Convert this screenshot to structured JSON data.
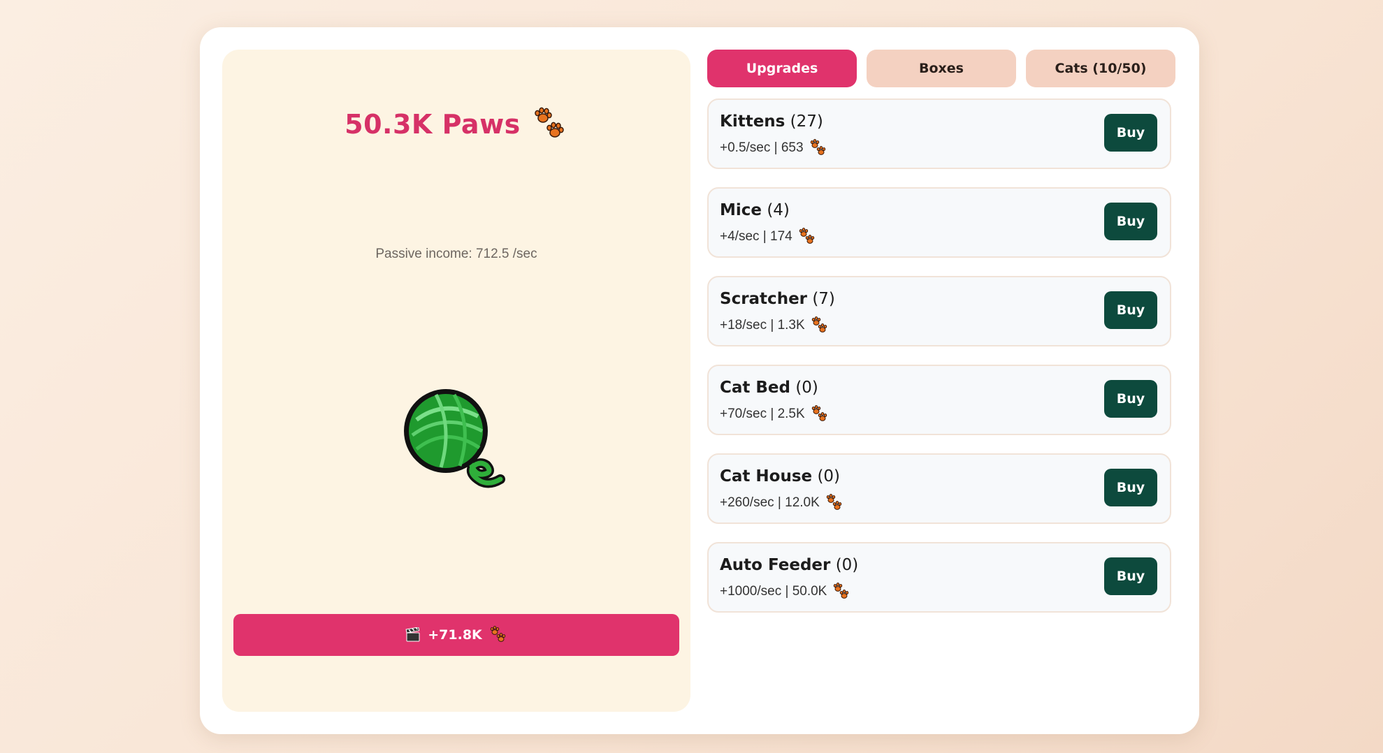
{
  "game": {
    "paws_count": "50.3K Paws",
    "passive_income": "Passive income: 712.5 /sec",
    "yarn_icon": "yarn-ball-icon",
    "paw_icon": "paw-prints-icon"
  },
  "ad_button": {
    "icon": "clapperboard-icon",
    "label": "+71.8K"
  },
  "tabs": [
    {
      "label": "Upgrades",
      "active": true
    },
    {
      "label": "Boxes",
      "active": false
    },
    {
      "label": "Cats (10/50)",
      "active": false
    }
  ],
  "upgrades": [
    {
      "name": "Kittens",
      "count": "(27)",
      "detail": "+0.5/sec | 653",
      "buy_label": "Buy"
    },
    {
      "name": "Mice",
      "count": "(4)",
      "detail": "+4/sec | 174",
      "buy_label": "Buy"
    },
    {
      "name": "Scratcher",
      "count": "(7)",
      "detail": "+18/sec | 1.3K",
      "buy_label": "Buy"
    },
    {
      "name": "Cat Bed",
      "count": "(0)",
      "detail": "+70/sec | 2.5K",
      "buy_label": "Buy"
    },
    {
      "name": "Cat House",
      "count": "(0)",
      "detail": "+260/sec | 12.0K",
      "buy_label": "Buy"
    },
    {
      "name": "Auto Feeder",
      "count": "(0)",
      "detail": "+1000/sec | 50.0K",
      "buy_label": "Buy"
    }
  ],
  "colors": {
    "accent": "#e0336c",
    "paws_text": "#d63167",
    "buy_button": "#0d4a3d",
    "tab_inactive": "#f4d1c1",
    "panel_bg": "#fdf4e3"
  }
}
